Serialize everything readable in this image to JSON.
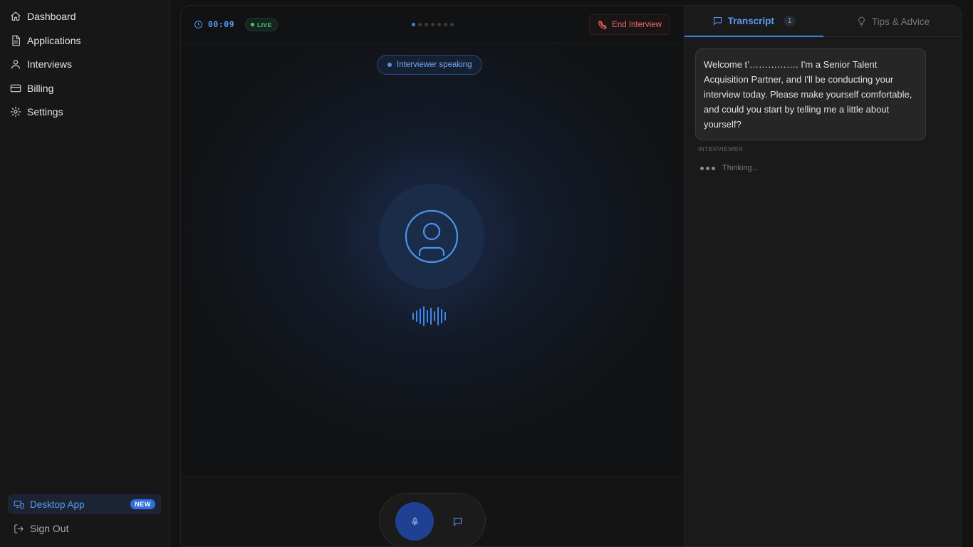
{
  "sidebar": {
    "items": [
      {
        "label": "Dashboard",
        "icon": "home-icon"
      },
      {
        "label": "Applications",
        "icon": "document-icon"
      },
      {
        "label": "Interviews",
        "icon": "user-icon"
      },
      {
        "label": "Billing",
        "icon": "credit-card-icon"
      },
      {
        "label": "Settings",
        "icon": "gear-icon"
      }
    ],
    "desktop_app": {
      "label": "Desktop App",
      "badge": "NEW",
      "icon": "monitor-phone-icon"
    },
    "sign_out": {
      "label": "Sign Out",
      "icon": "sign-out-icon"
    }
  },
  "session": {
    "timer": "00:09",
    "live_label": "LIVE",
    "end_button": "End Interview",
    "status_pill": "Interviewer speaking",
    "pager_total": 7,
    "pager_active": 1
  },
  "transcript_panel": {
    "tabs": [
      {
        "label": "Transcript",
        "count": "1",
        "icon": "chat-icon"
      },
      {
        "label": "Tips & Advice",
        "icon": "lightbulb-icon"
      }
    ],
    "messages": [
      {
        "text": "Welcome t’……………. I'm a Senior Talent Acquisition Partner, and I'll be conducting your interview today. Please make yourself comfortable, and could you start by telling me a little about yourself?",
        "role": "INTERVIEWER"
      }
    ],
    "thinking_label": "Thinking..."
  },
  "colors": {
    "accent": "#3f7ee8",
    "live_green": "#3ecf72",
    "danger": "#ef6a6a",
    "background": "#111214"
  }
}
